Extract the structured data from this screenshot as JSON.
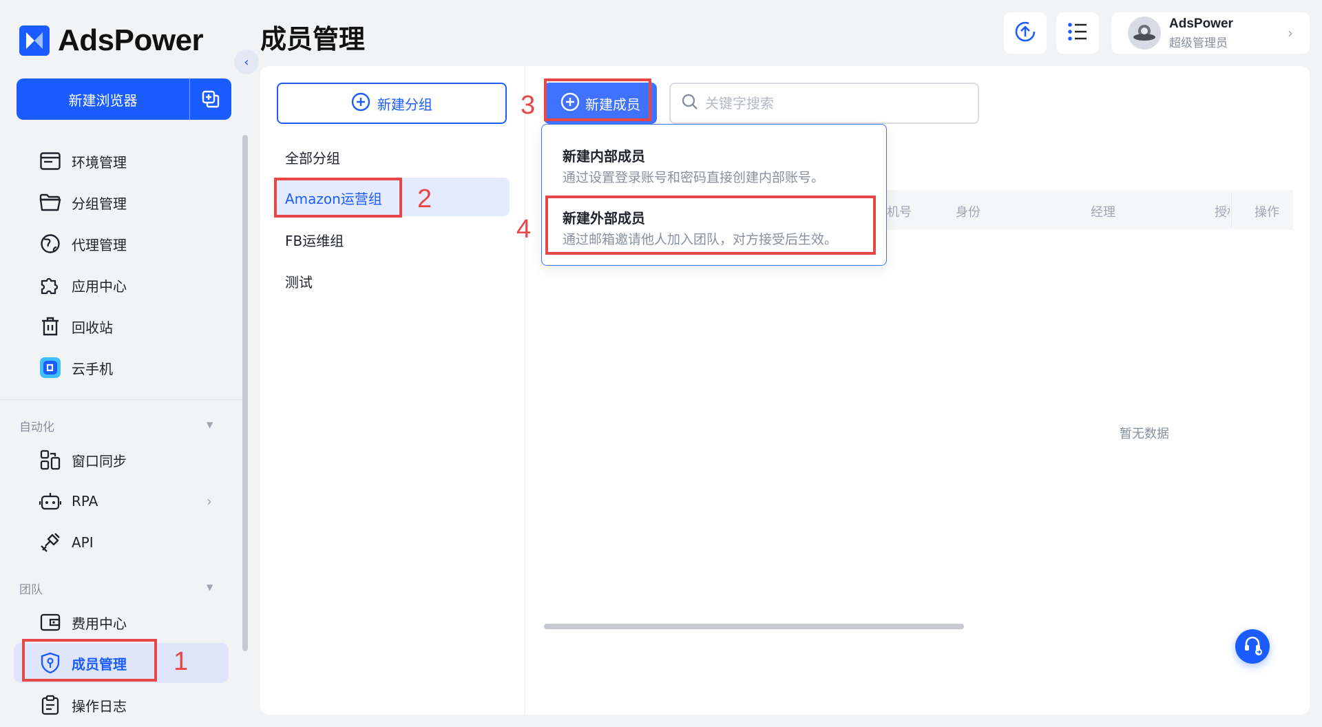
{
  "app": {
    "name": "AdsPower"
  },
  "sidebar": {
    "new_browser_label": "新建浏览器",
    "items": [
      {
        "label": "环境管理",
        "icon": "browser-window-icon"
      },
      {
        "label": "分组管理",
        "icon": "folder-icon"
      },
      {
        "label": "代理管理",
        "icon": "globe-icon"
      },
      {
        "label": "应用中心",
        "icon": "puzzle-icon"
      },
      {
        "label": "回收站",
        "icon": "trash-icon"
      },
      {
        "label": "云手机",
        "icon": "cloud-phone-icon"
      }
    ],
    "automation": {
      "title": "自动化",
      "items": [
        {
          "label": "窗口同步",
          "icon": "window-sync-icon"
        },
        {
          "label": "RPA",
          "icon": "robot-icon"
        },
        {
          "label": "API",
          "icon": "plug-icon"
        }
      ]
    },
    "team": {
      "title": "团队",
      "items": [
        {
          "label": "费用中心",
          "icon": "wallet-icon"
        },
        {
          "label": "成员管理",
          "icon": "shield-key-icon"
        },
        {
          "label": "操作日志",
          "icon": "clipboard-icon"
        }
      ]
    }
  },
  "header": {
    "title": "成员管理",
    "profile": {
      "name": "AdsPower",
      "role": "超级管理员"
    }
  },
  "groups": {
    "new_group_label": "新建分组",
    "items": [
      "全部分组",
      "Amazon运营组",
      "FB运维组",
      "测试"
    ],
    "selected": "Amazon运营组"
  },
  "members": {
    "new_member_label": "新建成员",
    "search_placeholder": "关键字搜索",
    "columns": [
      "机号",
      "身份",
      "经理",
      "授权",
      "操作"
    ],
    "empty_text": "暂无数据"
  },
  "dropdown": {
    "internal": {
      "title": "新建内部成员",
      "desc": "通过设置登录账号和密码直接创建内部账号。"
    },
    "external": {
      "title": "新建外部成员",
      "desc": "通过邮箱邀请他人加入团队，对方接受后生效。"
    }
  },
  "annotations": [
    "1",
    "2",
    "3",
    "4"
  ],
  "colors": {
    "accent": "#1a5cff",
    "annotation": "#e8474a",
    "selected_bg": "#dfe5fb"
  }
}
